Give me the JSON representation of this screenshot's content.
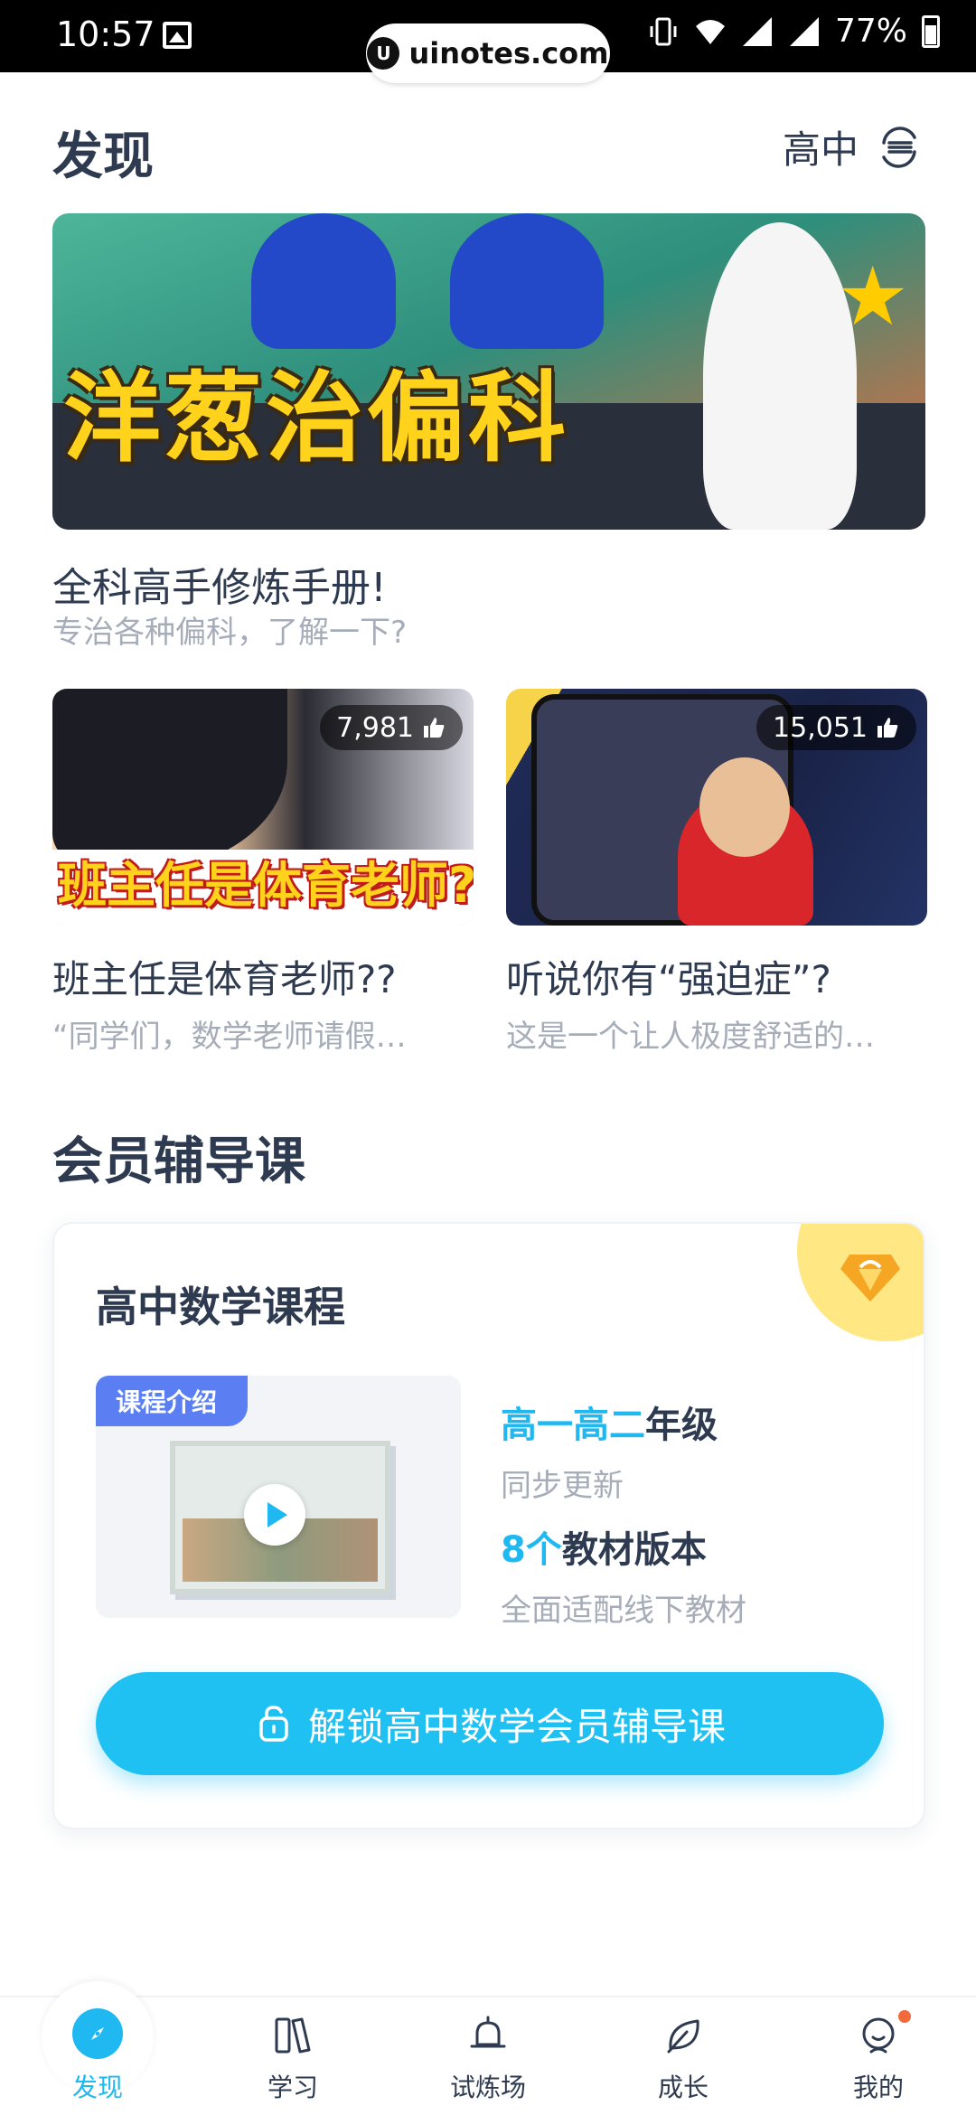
{
  "status_bar": {
    "time": "10:57",
    "url": "uinotes.com",
    "battery": "77%"
  },
  "header": {
    "title": "发现",
    "grade": "高中"
  },
  "banner": {
    "title_art": "洋葱治偏科",
    "title": "全科高手修炼手册!",
    "subtitle": "专治各种偏科，了解一下?"
  },
  "videos": [
    {
      "likes": "7,981",
      "thumb_text": "班主任是体育老师?",
      "title": "班主任是体育老师??",
      "subtitle": "“同学们，数学老师请假…"
    },
    {
      "likes": "15,051",
      "thumb_text": "",
      "title": "听说你有“强迫症”?",
      "subtitle": "这是一个让人极度舒适的…"
    }
  ],
  "section": {
    "title": "会员辅导课"
  },
  "course": {
    "name": "高中数学课程",
    "intro_tag": "课程介绍",
    "feature1_highlight": "高一高二",
    "feature1_rest": "年级",
    "feature1_sub": "同步更新",
    "feature2_highlight": "8个",
    "feature2_rest": "教材版本",
    "feature2_sub": "全面适配线下教材",
    "unlock_label": "解锁高中数学会员辅导课"
  },
  "bottom_nav": {
    "items": [
      {
        "label": "发现",
        "icon": "compass-icon",
        "active": true
      },
      {
        "label": "学习",
        "icon": "book-icon"
      },
      {
        "label": "试炼场",
        "icon": "bell-icon"
      },
      {
        "label": "成长",
        "icon": "leaf-icon"
      },
      {
        "label": "我的",
        "icon": "profile-icon",
        "badge": true
      }
    ]
  },
  "colors": {
    "accent": "#1fb8f0",
    "text": "#2e3a4f",
    "muted": "#a6adb8",
    "vip": "#ffe784",
    "tag": "#5b7ff2"
  }
}
